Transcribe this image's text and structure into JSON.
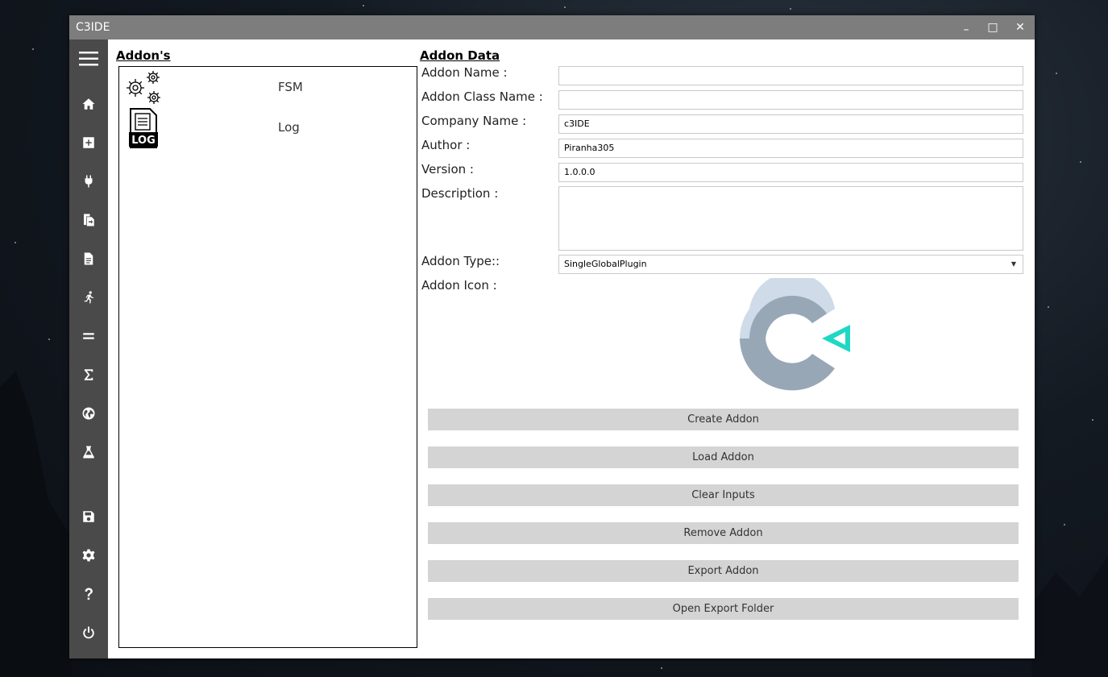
{
  "window": {
    "title": "C3IDE"
  },
  "window_controls": {
    "minimize": "–",
    "maximize": "□",
    "close": "✕"
  },
  "sidebar": {
    "items": [
      {
        "icon": "hamburger-icon"
      },
      {
        "icon": "home-icon"
      },
      {
        "icon": "add-icon"
      },
      {
        "icon": "plug-icon"
      },
      {
        "icon": "copy-file-icon"
      },
      {
        "icon": "document-icon"
      },
      {
        "icon": "running-man-icon"
      },
      {
        "icon": "equals-icon"
      },
      {
        "icon": "sigma-icon"
      },
      {
        "icon": "globe-icon"
      },
      {
        "icon": "flask-icon"
      },
      {
        "icon": "save-icon"
      },
      {
        "icon": "settings-icon"
      },
      {
        "icon": "help-icon"
      },
      {
        "icon": "power-icon"
      }
    ]
  },
  "addons": {
    "title": "Addon's",
    "items": [
      {
        "label": "FSM",
        "icon": "gears-icon"
      },
      {
        "label": "Log",
        "icon": "log-file-icon"
      }
    ]
  },
  "addon_data": {
    "title": "Addon Data",
    "fields": {
      "name_label": "Addon Name :",
      "name_value": "",
      "class_label": "Addon Class Name :",
      "class_value": "",
      "company_label": "Company Name :",
      "company_value": "c3IDE",
      "author_label": "Author :",
      "author_value": "Piranha305",
      "version_label": "Version :",
      "version_value": "1.0.0.0",
      "description_label": "Description :",
      "description_value": "",
      "type_label": "Addon Type::",
      "type_value": "SingleGlobalPlugin",
      "icon_label": "Addon Icon :"
    },
    "icon_colors": {
      "light": "#cfdbe8",
      "dark": "#97a7b6",
      "accent": "#1fd8c4"
    }
  },
  "buttons": {
    "create": "Create Addon",
    "load": "Load Addon",
    "clear": "Clear Inputs",
    "remove": "Remove Addon",
    "export": "Export Addon",
    "open_folder": "Open Export Folder"
  }
}
